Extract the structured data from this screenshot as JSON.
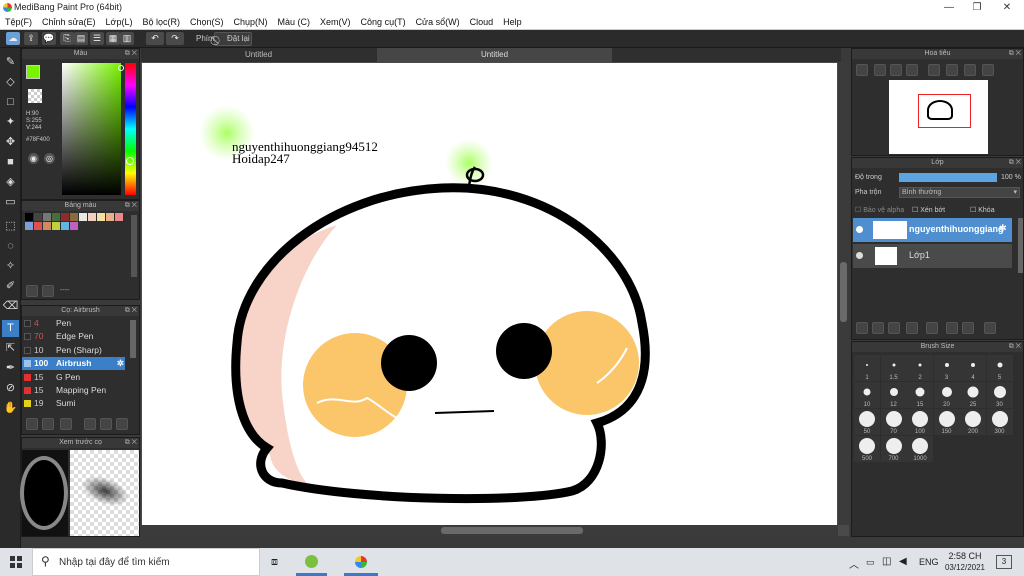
{
  "app": {
    "title": "MediBang Paint Pro (64bit)"
  },
  "menu": [
    "Tệp(F)",
    "Chỉnh sửa(E)",
    "Lớp(L)",
    "Bộ lọc(R)",
    "Chọn(S)",
    "Chụp(N)",
    "Màu (C)",
    "Xem(V)",
    "Công cụ(T)",
    "Cửa sổ(W)",
    "Cloud",
    "Help"
  ],
  "toolbar": {
    "shortcut_label": "Phím",
    "reset_label": "Đặt lại"
  },
  "tabs": [
    "Untitled",
    "Untitled"
  ],
  "color_panel": {
    "title": "Màu",
    "h": "H:90",
    "s": "S:255",
    "v": "V:244",
    "hex": "#78F400",
    "fg": "#78f400",
    "bg": "#000000"
  },
  "palette_panel": {
    "title": "Bảng màu",
    "footer": "----",
    "colors": [
      "#000000",
      "#444444",
      "#777777",
      "#4a6b3a",
      "#8b2d2d",
      "#8b6b3b",
      "#e8e8e8",
      "#f4d0c0",
      "#f6e0a0",
      "#e9b08a",
      "#e88a8a",
      "#7aa0d8",
      "#e05050",
      "#d08a60",
      "#c0d040",
      "#5db8e0",
      "#c060c0"
    ]
  },
  "brush_panel": {
    "title": "Cọ: Airbrush",
    "items": [
      {
        "size": "4",
        "name": "Pen",
        "color": "#2a2a2a"
      },
      {
        "size": "70",
        "name": "Edge Pen",
        "color": "#2a2a2a"
      },
      {
        "size": "10",
        "name": "Pen (Sharp)",
        "color": "#2a2a2a"
      },
      {
        "size": "100",
        "name": "Airbrush",
        "color": "#5b9bd5",
        "selected": true
      },
      {
        "size": "15",
        "name": "G Pen",
        "color": "#e03030"
      },
      {
        "size": "15",
        "name": "Mapping Pen",
        "color": "#e03030"
      },
      {
        "size": "19",
        "name": "Sumi",
        "color": "#e0d020"
      }
    ]
  },
  "preview_panel": {
    "title": "Xem trước cọ"
  },
  "navigator": {
    "title": "Hoa tiêu"
  },
  "layers_panel": {
    "title": "Lớp",
    "opacity_label": "Độ trong",
    "opacity_value": "100 %",
    "blend_label": "Pha trộn",
    "blend_value": "Bình thường",
    "protect_alpha": "Bảo vệ alpha",
    "clipping": "Xén bớt",
    "lock": "Khóa",
    "layers": [
      {
        "name": "nguyenthihuonggiang",
        "selected": true
      },
      {
        "name": "Lớp1",
        "selected": false
      }
    ]
  },
  "brushsize_panel": {
    "title": "Brush Size",
    "sizes": [
      "1",
      "1.5",
      "2",
      "3",
      "4",
      "5",
      "10",
      "12",
      "15",
      "20",
      "25",
      "30",
      "50",
      "70",
      "100",
      "150",
      "200",
      "300",
      "500",
      "700",
      "1000"
    ]
  },
  "canvas": {
    "text1": "nguyenthihuonggiang94512",
    "text2": "Hoidap247"
  },
  "taskbar": {
    "search_placeholder": "Nhập tại đây để tìm kiếm",
    "lang": "ENG",
    "time": "2:58 CH",
    "date": "03/12/2021",
    "notif_count": "3"
  }
}
